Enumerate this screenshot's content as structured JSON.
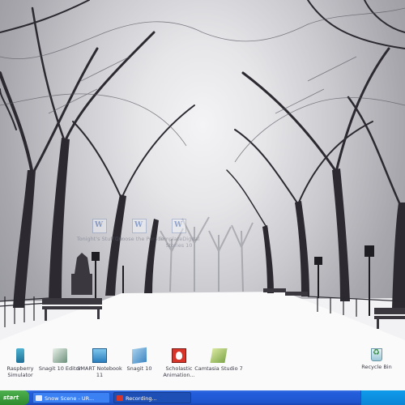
{
  "desktop": {
    "icons": [
      {
        "id": "word-doc-1",
        "label": "Tonight's Stuff 10",
        "icon": "word-document-icon",
        "faded": true
      },
      {
        "id": "word-doc-2",
        "label": "Choose the Person",
        "icon": "word-document-icon",
        "faded": true
      },
      {
        "id": "word-doc-3",
        "label": "TemplateDigital Stories 10",
        "icon": "word-document-icon",
        "faded": true
      },
      {
        "id": "raspberry",
        "label": "Raspberry Simulator",
        "icon": "usb-drive-icon",
        "faded": false
      },
      {
        "id": "snagit-editor",
        "label": "Snagit 10 Editor",
        "icon": "snagit-editor-icon",
        "faded": false
      },
      {
        "id": "smart-notebook",
        "label": "SMART Notebook 11",
        "icon": "smart-notebook-icon",
        "faded": false
      },
      {
        "id": "snagit",
        "label": "Snagit 10",
        "icon": "snagit-icon",
        "faded": false
      },
      {
        "id": "anim",
        "label": "Scholastic Animation...",
        "icon": "animation-app-icon",
        "faded": false
      },
      {
        "id": "camtasia",
        "label": "Camtasia Studio 7",
        "icon": "camtasia-icon",
        "faded": false
      },
      {
        "id": "recycle-bin",
        "label": "Recycle Bin",
        "icon": "recycle-bin-icon",
        "faded": false
      }
    ]
  },
  "taskbar": {
    "start_label": "start",
    "buttons": [
      {
        "label": "Snow Scene - UR...",
        "icon": "browser-icon"
      },
      {
        "label": "Recording...",
        "icon": "record-icon"
      }
    ]
  }
}
